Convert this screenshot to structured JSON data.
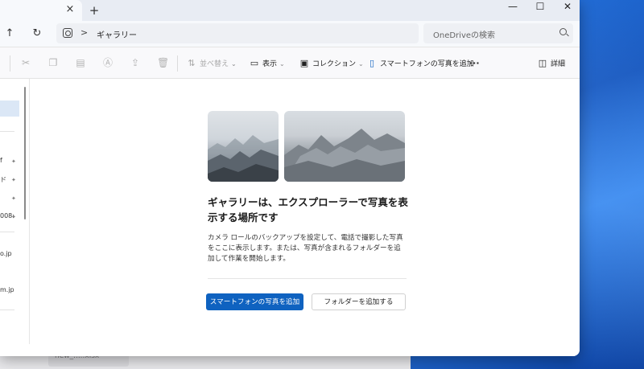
{
  "window": {
    "tab_close": "×",
    "new_tab": "+",
    "minimize": "—",
    "maximize": "☐",
    "close": "✕"
  },
  "nav": {
    "up": "↑",
    "refresh": "↻",
    "breadcrumb_sep": ">",
    "location": "ギャラリー"
  },
  "search": {
    "placeholder": "OneDriveの検索"
  },
  "toolbar": {
    "sort_label": "並べ替え",
    "view_label": "表示",
    "collection_label": "コレクション",
    "add_phone_photos_label": "スマートフォンの写真を追加",
    "more_label": "···",
    "details_label": "詳細"
  },
  "sidebar": {
    "items": [
      {
        "label": "f",
        "pinned": true
      },
      {
        "label": "ド",
        "pinned": true
      },
      {
        "label": "",
        "pinned": true
      },
      {
        "label": "008:",
        "pinned": true
      },
      {
        "label": "o.jp",
        "pinned": false
      },
      {
        "label": "m.jp",
        "pinned": false
      }
    ],
    "pin_glyph": "✦"
  },
  "gallery_empty": {
    "heading": "ギャラリーは、エクスプローラーで写真を表示する場所です",
    "description": "カメラ ロールのバックアップを設定して、電話で撮影した写真をここに表示します。または、写真が含まれるフォルダーを追加して作業を開始します。",
    "primary_button": "スマートフォンの写真を追加",
    "secondary_button": "フォルダーを追加する"
  },
  "background_window": {
    "item_text": "new_.....xlsx"
  },
  "colors": {
    "accent": "#0f62c0",
    "wallpaper": "#1a6fe0"
  }
}
